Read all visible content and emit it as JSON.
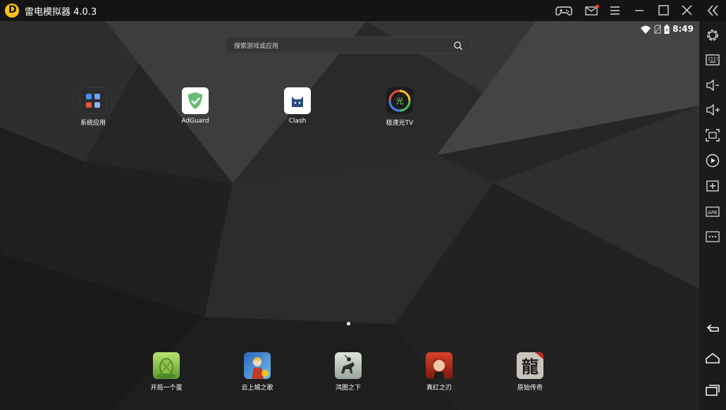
{
  "window": {
    "title": "雷电模拟器 4.0.3",
    "titlebar_bg": "#141414",
    "sidebar_bg": "#1b1b1b"
  },
  "titlebar_controls": [
    {
      "name": "gamepad-icon"
    },
    {
      "name": "mail-icon"
    },
    {
      "name": "menu-icon"
    },
    {
      "name": "minimize-icon"
    },
    {
      "name": "maximize-icon"
    },
    {
      "name": "close-icon"
    },
    {
      "name": "collapse-sidebar-icon"
    }
  ],
  "status_bar": {
    "time": "8:49",
    "wifi": "wifi-icon",
    "sim": "no-sim-icon",
    "battery": "battery-icon"
  },
  "search": {
    "placeholder": "搜索游戏或应用"
  },
  "desktop_apps": [
    {
      "label": "系统应用",
      "icon": "folder-icon"
    },
    {
      "label": "AdGuard",
      "icon": "adguard-shield-icon"
    },
    {
      "label": "Clash",
      "icon": "clash-cat-icon"
    },
    {
      "label": "极速光TV",
      "icon": "guang-tv-icon"
    }
  ],
  "page_indicator": {
    "current": 1,
    "total": 1
  },
  "dock_apps": [
    {
      "label": "开局一个蛋",
      "icon": "egg-game-icon"
    },
    {
      "label": "云上城之歌",
      "icon": "cloud-city-game-icon"
    },
    {
      "label": "鸿图之下",
      "icon": "horseman-game-icon"
    },
    {
      "label": "真红之刃",
      "icon": "red-blade-game-icon"
    },
    {
      "label": "原始传奇",
      "icon": "legend-game-icon"
    }
  ],
  "sidebar_tools": [
    {
      "name": "settings-icon"
    },
    {
      "name": "keyboard-icon"
    },
    {
      "name": "volume-down-icon"
    },
    {
      "name": "volume-up-icon"
    },
    {
      "name": "fullscreen-icon"
    },
    {
      "name": "screen-record-icon"
    },
    {
      "name": "add-app-icon"
    },
    {
      "name": "apk-install-icon",
      "text": "APK"
    },
    {
      "name": "more-icon"
    },
    {
      "name": "back-icon"
    },
    {
      "name": "home-icon"
    },
    {
      "name": "recent-apps-icon"
    }
  ]
}
